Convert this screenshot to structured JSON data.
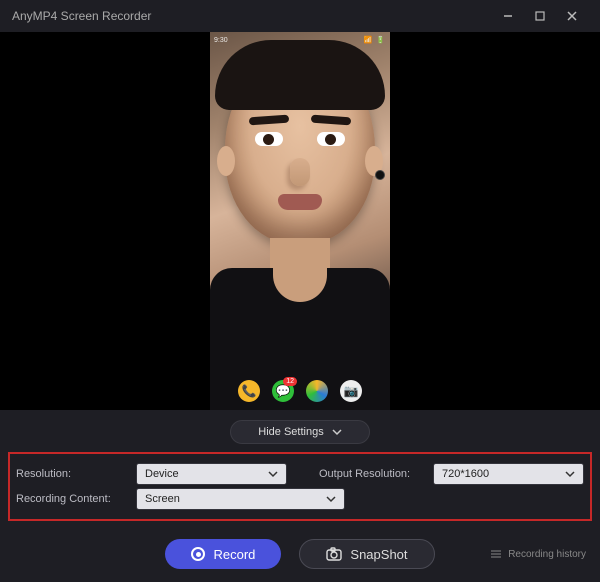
{
  "app": {
    "title": "AnyMP4 Screen Recorder"
  },
  "phone": {
    "statusbar_time": "9:30",
    "statusbar_icons": "📶 🔋",
    "dock_badge_messages": "12"
  },
  "settings_toggle": {
    "label": "Hide Settings"
  },
  "settings": {
    "resolution_label": "Resolution:",
    "resolution_value": "Device",
    "output_resolution_label": "Output Resolution:",
    "output_resolution_value": "720*1600",
    "recording_content_label": "Recording Content:",
    "recording_content_value": "Screen"
  },
  "actions": {
    "record_label": "Record",
    "snapshot_label": "SnapShot",
    "history_label": "Recording history"
  },
  "colors": {
    "accent": "#4a52dc",
    "highlight_border": "#c62828"
  }
}
